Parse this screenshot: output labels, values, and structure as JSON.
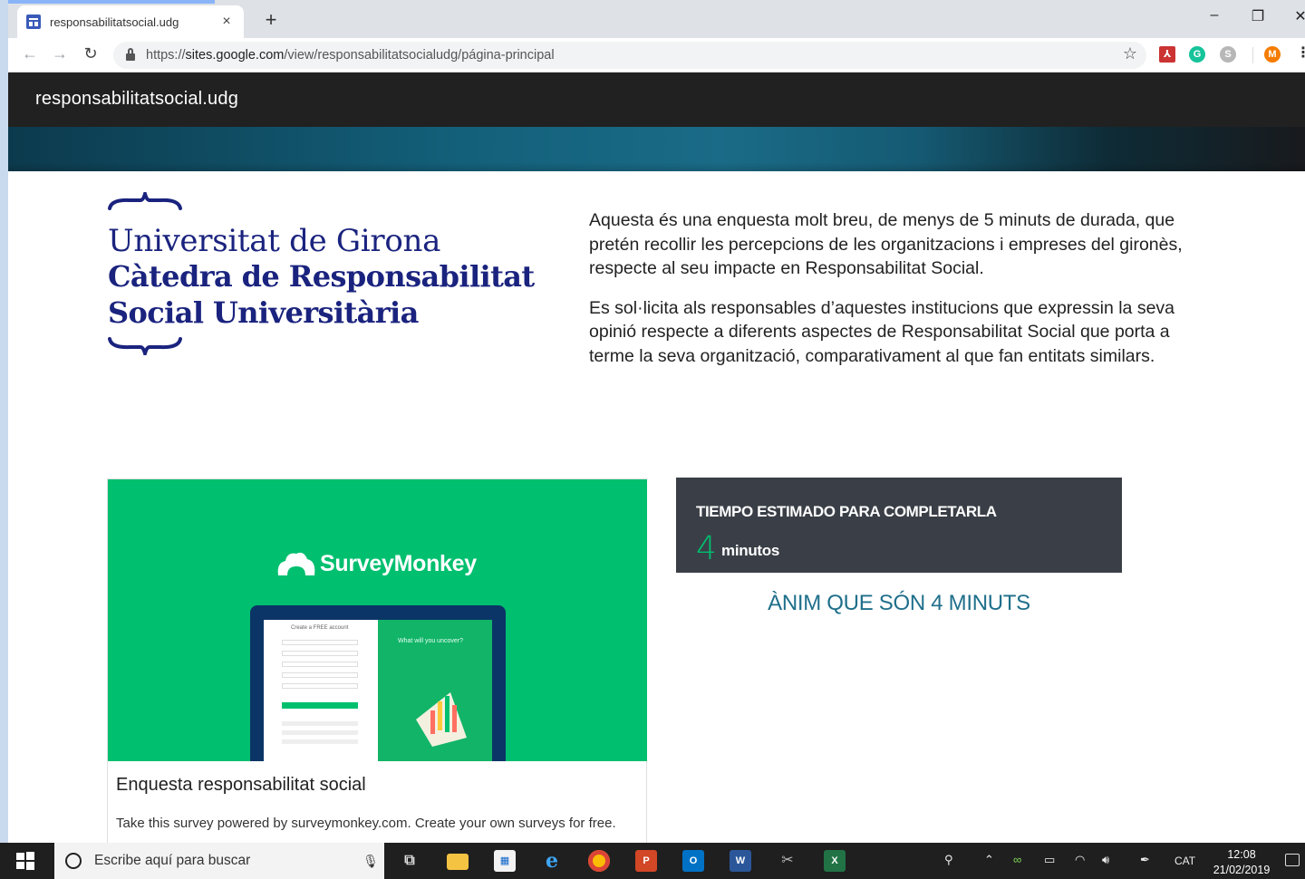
{
  "browser": {
    "tab_title": "responsabilitatsocial.udg",
    "tab_close": "×",
    "new_tab": "+",
    "url_scheme": "https://",
    "url_host": "sites.google.com",
    "url_path": "/view/responsabilitatsocialudg/página-principal",
    "window_controls": {
      "minimize": "–",
      "restore": "❐",
      "close": "✕"
    },
    "extensions": [
      "pdf-icon",
      "grammarly-icon",
      "skype-icon",
      "profile-avatar"
    ],
    "profile_initial": "M",
    "grammarly_letter": "G",
    "skype_letter": "S"
  },
  "site": {
    "title": "responsabilitatsocial.udg",
    "logo": {
      "line1": "Universitat de Girona",
      "line2": "Càtedra de Responsabilitat",
      "line3": "Social Universitària",
      "color": "#1a237e"
    },
    "intro": [
      "Aquesta és una enquesta molt breu, de menys de 5 minuts de durada, que pretén recollir les percepcions de les organitzacions i empreses del gironès, respecte al seu impacte en Responsabilitat Social.",
      "Es sol·licita als responsables d’aquestes institucions que expressin la seva opinió respecte a diferents aspectes de Responsabilitat Social que porta a terme la seva organització, comparativament al que fan entitats similars."
    ],
    "survey_card": {
      "brand": "SurveyMonkey",
      "brand_color": "#00bf6f",
      "preview_form_title": "Create a FREE account",
      "preview_tagline": "What will you uncover?",
      "title": "Enquesta responsabilitat social",
      "subtitle": "Take this survey powered by surveymonkey.com. Create your own surveys for free."
    },
    "time_box": {
      "label": "TIEMPO ESTIMADO PARA COMPLETARLA",
      "value": "4",
      "unit": "minutos"
    },
    "encourage": "ÀNIM QUE SÓN 4 MINUTS"
  },
  "taskbar": {
    "search_placeholder": "Escribe aquí para buscar",
    "pinned": [
      "task-view-icon",
      "file-explorer-icon",
      "store-icon",
      "edge-icon",
      "chrome-icon",
      "powerpoint-icon",
      "outlook-icon",
      "word-icon",
      "snipping-tool-icon",
      "excel-icon"
    ],
    "language": "CAT",
    "time": "12:08",
    "date": "21/02/2019"
  }
}
